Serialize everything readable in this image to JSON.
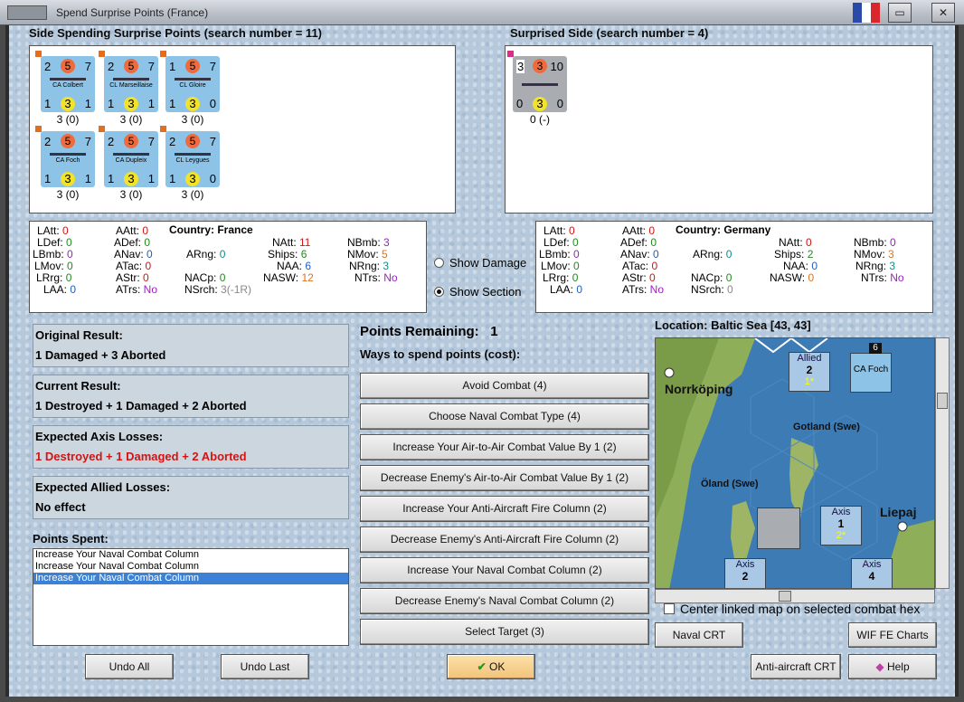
{
  "window": {
    "title": "Spend Surprise Points (France)",
    "min": "▭",
    "close": "✕"
  },
  "left_side": {
    "header": "Side Spending Surprise Points (search number = 11)",
    "units": [
      {
        "top": "2",
        "mid": "5",
        "right": "7",
        "name": "CA Colbert",
        "bl": "1",
        "bm": "3",
        "br": "1",
        "label": "3 (0)"
      },
      {
        "top": "2",
        "mid": "5",
        "right": "7",
        "name": "CL Marseillaise",
        "bl": "1",
        "bm": "3",
        "br": "1",
        "label": "3 (0)"
      },
      {
        "top": "1",
        "mid": "5",
        "right": "7",
        "name": "CL Gloire",
        "bl": "1",
        "bm": "3",
        "br": "0",
        "label": "3 (0)"
      },
      {
        "top": "2",
        "mid": "5",
        "right": "7",
        "name": "CA Foch",
        "bl": "1",
        "bm": "3",
        "br": "1",
        "label": "3 (0)"
      },
      {
        "top": "2",
        "mid": "5",
        "right": "7",
        "name": "CA Dupleix",
        "bl": "1",
        "bm": "3",
        "br": "1",
        "label": "3 (0)"
      },
      {
        "top": "2",
        "mid": "5",
        "right": "7",
        "name": "CL Leygues",
        "bl": "1",
        "bm": "3",
        "br": "0",
        "label": "3 (0)"
      }
    ]
  },
  "right_side": {
    "header": "Surprised Side (search number = 4)",
    "unit": {
      "top": "3",
      "mid": "3",
      "right": "10",
      "bl": "0",
      "bm": "3",
      "br": "0",
      "label": "0 (-)"
    }
  },
  "stats_left": {
    "country": "Country: France",
    "latt": "LAtt:",
    "latt_v": "0",
    "ldef": "LDef:",
    "ldef_v": "0",
    "lbmb": "LBmb:",
    "lbmb_v": "0",
    "lmov": "LMov:",
    "lmov_v": "0",
    "lrrg": "LRrg:",
    "lrrg_v": "0",
    "laa": "LAA:",
    "laa_v": "0",
    "aatt": "AAtt:",
    "aatt_v": "0",
    "adef": "ADef:",
    "adef_v": "0",
    "anav": "ANav:",
    "anav_v": "0",
    "atac": "ATac:",
    "atac_v": "0",
    "astr": "AStr:",
    "astr_v": "0",
    "atrs": "ATrs:",
    "atrs_v": "No",
    "arng": "ARng:",
    "arng_v": "0",
    "nacp": "NACp:",
    "nacp_v": "0",
    "nsrch": "NSrch:",
    "nsrch_v": "3(-1R)",
    "natt": "NAtt:",
    "natt_v": "11",
    "ships": "Ships:",
    "ships_v": "6",
    "naa": "NAA:",
    "naa_v": "6",
    "nasw": "NASW:",
    "nasw_v": "12",
    "nbmb": "NBmb:",
    "nbmb_v": "3",
    "nmov": "NMov:",
    "nmov_v": "5",
    "nrng": "NRng:",
    "nrng_v": "3",
    "ntrs": "NTrs:",
    "ntrs_v": "No"
  },
  "stats_right": {
    "country": "Country: Germany",
    "latt_v": "0",
    "ldef_v": "0",
    "lbmb_v": "0",
    "lmov_v": "0",
    "lrrg_v": "0",
    "laa_v": "0",
    "aatt_v": "0",
    "adef_v": "0",
    "anav_v": "0",
    "atac_v": "0",
    "astr_v": "0",
    "atrs_v": "No",
    "arng_v": "0",
    "nacp_v": "0",
    "nsrch_v": "0",
    "natt_v": "0",
    "ships_v": "2",
    "naa_v": "0",
    "nasw_v": "0",
    "nbmb_v": "0",
    "nmov_v": "3",
    "nrng_v": "3",
    "ntrs_v": "No"
  },
  "options": {
    "show_damage": "Show Damage",
    "show_section": "Show Section"
  },
  "results": {
    "original_t": "Original Result:",
    "original_v": "1 Damaged + 3 Aborted",
    "current_t": "Current Result:",
    "current_v": "1 Destroyed + 1 Damaged + 2 Aborted",
    "axis_t": "Expected Axis Losses:",
    "axis_v": "1 Destroyed + 1 Damaged + 2 Aborted",
    "allied_t": "Expected Allied Losses:",
    "allied_v": "No effect"
  },
  "points": {
    "spent_label": "Points Spent:",
    "spent": [
      "Increase Your Naval Combat Column",
      "Increase Your Naval Combat Column",
      "Increase Your Naval Combat Column"
    ],
    "remaining_label": "Points Remaining:",
    "remaining": "1",
    "ways_label": "Ways to spend points (cost):"
  },
  "spend_options": [
    "Avoid Combat (4)",
    "Choose Naval Combat Type (4)",
    "Increase Your Air-to-Air Combat Value By 1 (2)",
    "Decrease Enemy's Air-to-Air Combat Value By 1 (2)",
    "Increase Your Anti-Aircraft Fire Column (2)",
    "Decrease Enemy's Anti-Aircraft Fire Column (2)",
    "Increase Your Naval Combat Column (2)",
    "Decrease Enemy's Naval Combat Column (2)",
    "Select Target (3)"
  ],
  "map": {
    "location": "Location: Baltic Sea [43, 43]",
    "norrkoping": "Norrköping",
    "gotland": "Gotland (Swe)",
    "oland": "Öland (Swe)",
    "liepaja": "Liepaj",
    "allied": "Allied",
    "allied_n": "2",
    "allied_s": "1*",
    "axis1": "Axis",
    "axis1_n": "1",
    "axis1_s": "2*",
    "axis2": "Axis",
    "axis2_n": "2",
    "axis3": "Axis",
    "axis3_n": "4",
    "stack": "6",
    "counter_name": "CA Foch",
    "center_label": "Center linked map on selected combat hex"
  },
  "buttons": {
    "undo_all": "Undo All",
    "undo_last": "Undo Last",
    "ok": "OK",
    "naval_crt": "Naval CRT",
    "wif_charts": "WIF FE Charts",
    "aa_crt": "Anti-aircraft CRT",
    "help": "Help"
  }
}
